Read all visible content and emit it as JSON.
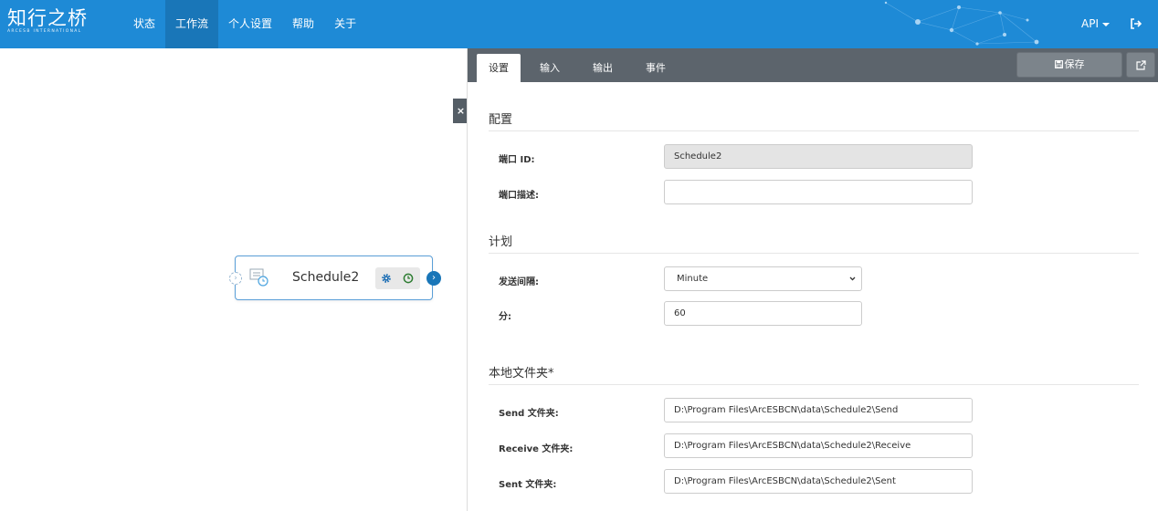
{
  "brand": {
    "logo_cn": "知行之桥",
    "logo_en": "ARCESB INTERNATIONAL"
  },
  "nav": {
    "items": [
      {
        "label": "状态"
      },
      {
        "label": "工作流"
      },
      {
        "label": "个人设置"
      },
      {
        "label": "帮助"
      },
      {
        "label": "关于"
      }
    ],
    "active_index": 1,
    "api_label": "API",
    "logout_icon": "sign-out-icon"
  },
  "canvas": {
    "close_label": "×",
    "node": {
      "title": "Schedule2",
      "icon": "schedule-alarm-icon",
      "tools": [
        "gear-icon",
        "clock-icon"
      ]
    }
  },
  "panel": {
    "tabs": [
      {
        "label": "设置"
      },
      {
        "label": "输入"
      },
      {
        "label": "输出"
      },
      {
        "label": "事件"
      }
    ],
    "active_tab": 0,
    "save_label": "保存",
    "sections": {
      "config": {
        "title": "配置",
        "port_id_label": "端口 ID:",
        "port_id_value": "Schedule2",
        "port_desc_label": "端口描述:",
        "port_desc_value": ""
      },
      "plan": {
        "title": "计划",
        "interval_label": "发送间隔:",
        "interval_value": "Minute",
        "minute_label": "分:",
        "minute_value": "60"
      },
      "folders": {
        "title": "本地文件夹*",
        "send_label": "Send 文件夹:",
        "send_value": "D:\\Program Files\\ArcESBCN\\data\\Schedule2\\Send",
        "receive_label": "Receive 文件夹:",
        "receive_value": "D:\\Program Files\\ArcESBCN\\data\\Schedule2\\Receive",
        "sent_label": "Sent 文件夹:",
        "sent_value": "D:\\Program Files\\ArcESBCN\\data\\Schedule2\\Sent"
      }
    }
  },
  "colors": {
    "topbar": "#1e8ad6",
    "nav_active": "#1976b8",
    "tabbar": "#5c646c",
    "node_border": "#5a9fd8"
  }
}
